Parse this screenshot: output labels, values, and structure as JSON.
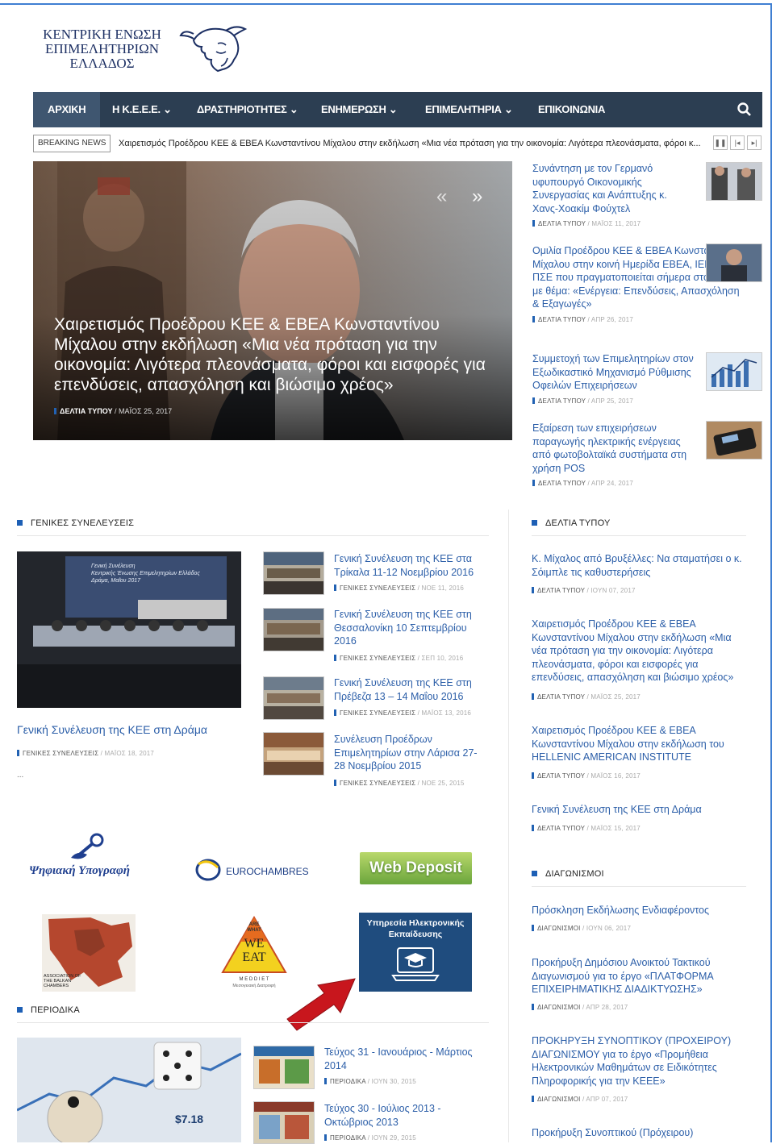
{
  "header": {
    "logo_line1": "ΚΕΝΤΡΙΚΗ ΕΝΩΣΗ",
    "logo_line2": "ΕΠΙΜΕΛΗΤΗΡΙΩΝ",
    "logo_line3": "ΕΛΛΑΔΟΣ"
  },
  "nav": {
    "items": [
      "ΑΡΧΙΚΗ",
      "Η Κ.Ε.Ε.Ε.",
      "ΔΡΑΣΤΗΡΙΟΤΗΤΕΣ",
      "ΕΝΗΜΕΡΩΣΗ",
      "ΕΠΙΜΕΛΗΤΗΡΙΑ",
      "ΕΠΙΚΟΙΝΩΝΙΑ"
    ],
    "active": "ΑΡΧΙΚΗ"
  },
  "breaking": {
    "label": "BREAKING NEWS",
    "text": "Χαιρετισμός Προέδρου ΚΕΕ & ΕΒΕΑ Κωνσταντίνου Μίχαλου στην εκδήλωση «Μια νέα πρόταση για την οικονομία: Λιγότερα πλεονάσματα, φόροι κ..."
  },
  "hero": {
    "title": "Χαιρετισμός Προέδρου ΚΕΕ & ΕΒΕΑ Κωνσταντίνου Μίχαλου στην εκδήλωση «Μια νέα πρόταση για την οικονομία: Λιγότερα πλεονάσματα, φόροι και εισφορές για επενδύσεις, απασχόληση και βιώσιμο χρέος»",
    "category": "ΔΕΛΤΙΑ ΤΥΠΟΥ",
    "date": "ΜΑΪΟΣ 25, 2017"
  },
  "top_news": [
    {
      "title": "Συνάντηση με τον Γερμανό υφυπουργό Οικονομικής Συνεργασίας και Ανάπτυξης κ. Χανς-Χοακίμ Φούχτελ",
      "category": "ΔΕΛΤΙΑ ΤΥΠΟΥ",
      "date": "ΜΑΪΟΣ 11, 2017"
    },
    {
      "title": "Ομιλία Προέδρου ΚΕΕ & ΕΒΕΑ Κωνσταντίνου Μίχαλου στην κοινή Ημερίδα ΕΒΕΑ, ΙΕΝΕ και ΠΣΕ που πραγματοποιείται σήμερα στο ΕΒΕΑ με θέμα: «Ενέργεια: Επενδύσεις, Απασχόληση & Εξαγωγές»",
      "category": "ΔΕΛΤΙΑ ΤΥΠΟΥ",
      "date": "ΑΠΡ 26, 2017"
    },
    {
      "title": "Συμμετοχή των Επιμελητηρίων στον Εξωδικαστικό Μηχανισμό Ρύθμισης Οφειλών Επιχειρήσεων",
      "category": "ΔΕΛΤΙΑ ΤΥΠΟΥ",
      "date": "ΑΠΡ 25, 2017"
    },
    {
      "title": "Εξαίρεση των επιχειρήσεων παραγωγής ηλεκτρικής ενέργειας από φωτοβολταϊκά συστήματα στη χρήση POS",
      "category": "ΔΕΛΤΙΑ ΤΥΠΟΥ",
      "date": "ΑΠΡ 24, 2017"
    }
  ],
  "general_assemblies": {
    "heading": "ΓΕΝΙΚΕΣ ΣΥΝΕΛΕΥΣΕΙΣ",
    "main_title": "Γενική Συνέλευση της ΚΕΕ στη Δράμα",
    "main_category": "ΓΕΝΙΚΕΣ ΣΥΝΕΛΕΥΣΕΙΣ",
    "main_date": "ΜΑΪΟΣ 18, 2017",
    "ellipsis": "...",
    "banner_line1": "Γενική Συνέλευση",
    "banner_line2": "Κεντρικής Ένωσης Επιμελητηρίων Ελλάδος",
    "banner_line3": "Δράμα, Μαΐου 2017",
    "items": [
      {
        "title": "Γενική Συνέλευση της ΚΕΕ στα Τρίκαλα 11-12 Νοεμβρίου 2016",
        "category": "ΓΕΝΙΚΕΣ ΣΥΝΕΛΕΥΣΕΙΣ",
        "date": "ΝΟΕ 11, 2016"
      },
      {
        "title": "Γενική Συνέλευση της ΚΕΕ στη Θεσσαλονίκη 10 Σεπτεμβρίου 2016",
        "category": "ΓΕΝΙΚΕΣ ΣΥΝΕΛΕΥΣΕΙΣ",
        "date": "ΣΕΠ 10, 2016"
      },
      {
        "title": "Γενική Συνέλευση της ΚΕΕ στη Πρέβεζα 13 – 14 Μαΐου 2016",
        "category": "ΓΕΝΙΚΕΣ ΣΥΝΕΛΕΥΣΕΙΣ",
        "date": "ΜΑΪΟΣ 13, 2016"
      },
      {
        "title": "Συνέλευση Προέδρων Επιμελητηρίων στην Λάρισα 27-28 Νοεμβρίου 2015",
        "category": "ΓΕΝΙΚΕΣ ΣΥΝΕΛΕΥΣΕΙΣ",
        "date": "ΝΟΕ 25, 2015"
      }
    ]
  },
  "press_releases": {
    "heading": "ΔΕΛΤΙΑ ΤΥΠΟΥ",
    "items": [
      {
        "title": "Κ. Μίχαλος από Βρυξέλλες: Να σταματήσει ο κ. Σόιμπλε τις καθυστερήσεις",
        "category": "ΔΕΛΤΙΑ ΤΥΠΟΥ",
        "date": "ΙΟΥΝ 07, 2017"
      },
      {
        "title": "Χαιρετισμός Προέδρου ΚΕΕ & ΕΒΕΑ Κωνσταντίνου Μίχαλου στην εκδήλωση «Μια νέα πρόταση για την οικονομία: Λιγότερα πλεονάσματα, φόροι και εισφορές για επενδύσεις, απασχόληση και βιώσιμο χρέος»",
        "category": "ΔΕΛΤΙΑ ΤΥΠΟΥ",
        "date": "ΜΑΪΟΣ 25, 2017"
      },
      {
        "title": "Χαιρετισμός Προέδρου ΚΕΕ & ΕΒΕΑ Κωνσταντίνου Μίχαλου στην εκδήλωση του HELLENIC AMERICAN INSTITUTE",
        "category": "ΔΕΛΤΙΑ ΤΥΠΟΥ",
        "date": "ΜΑΪΟΣ 16, 2017"
      },
      {
        "title": "Γενική Συνέλευση της ΚΕΕ στη Δράμα",
        "category": "ΔΕΛΤΙΑ ΤΥΠΟΥ",
        "date": "ΜΑΪΟΣ 15, 2017"
      }
    ]
  },
  "tenders": {
    "heading": "ΔΙΑΓΩΝΙΣΜΟΙ",
    "items": [
      {
        "title": "Πρόσκληση Εκδήλωσης Ενδιαφέροντος",
        "category": "ΔΙΑΓΩΝΙΣΜΟΙ",
        "date": "ΙΟΥΝ 06, 2017"
      },
      {
        "title": "Προκήρυξη Δημόσιου Ανοικτού Τακτικού Διαγωνισμού για το έργο «ΠΛΑΤΦΟΡΜΑ ΕΠΙΧΕΙΡΗΜΑΤΙΚΗΣ ΔΙΑΔΙΚΤΥΩΣΗΣ»",
        "category": "ΔΙΑΓΩΝΙΣΜΟΙ",
        "date": "ΑΠΡ 28, 2017"
      },
      {
        "title": "ΠΡΟΚΗΡΥΞΗ ΣΥΝΟΠΤΙΚΟΥ (ΠΡΟΧΕΙΡΟΥ) ΔΙΑΓΩΝΙΣΜΟΥ για το έργο «Προμήθεια Ηλεκτρονικών Μαθημάτων σε Ειδικότητες Πληροφορικής για την ΚΕΕΕ»",
        "category": "ΔΙΑΓΩΝΙΣΜΟΙ",
        "date": "ΑΠΡ 07, 2017"
      },
      {
        "title": "Προκήρυξη Συνοπτικού (Πρόχειρου)",
        "category": "",
        "date": ""
      }
    ]
  },
  "partners": {
    "digital_signature": "Ψηφιακή Υπογραφή",
    "eurochambres": "EUROCHAMBRES",
    "web_deposit": "Web Deposit",
    "balkan_line1": "ASSOCIATION OF",
    "balkan_line2": "THE BALKAN",
    "balkan_line3": "CHAMBERS",
    "weeat_line1": "ARE",
    "weeat_line2": "WHAT",
    "weeat_line3": "WE",
    "weeat_line4": "EAT",
    "meddiet": "M E D D I E T",
    "meddiet_sub": "Μεσογειακή Διατροφή",
    "elearning_line1": "Υπηρεσία Ηλεκτρονικής",
    "elearning_line2": "Εκπαίδευσης"
  },
  "periodicals": {
    "heading": "ΠΕΡΙΟΔΙΚΑ",
    "items": [
      {
        "title": "Τεύχος 31 - Ιανουάριος - Μάρτιος 2014",
        "category": "ΠΕΡΙΟΔΙΚΑ",
        "date": "ΙΟΥΝ 30, 2015"
      },
      {
        "title": "Τεύχος 30 - Ιούλιος 2013 - Οκτώβριος 2013",
        "category": "ΠΕΡΙΟΔΙΚΑ",
        "date": "ΙΟΥΝ 29, 2015"
      }
    ]
  },
  "colors": {
    "nav_bg": "#2c3e52",
    "link": "#2b5ea8",
    "accent": "#1d5fb5",
    "arrow": "#c8161d"
  }
}
